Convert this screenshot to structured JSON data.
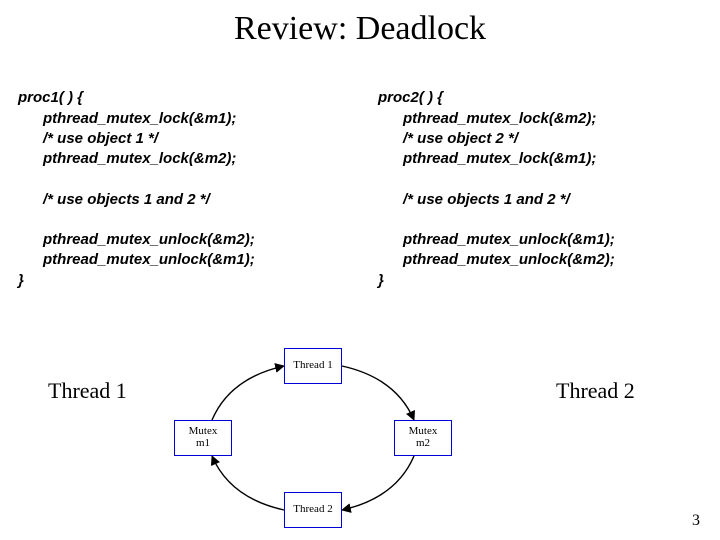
{
  "title": "Review: Deadlock",
  "slide_number": "3",
  "thread1_label": "Thread 1",
  "thread2_label": "Thread 2",
  "proc1": {
    "l0": "proc1( ) {",
    "l1": "      pthread_mutex_lock(&m1);",
    "l2": "      /* use object 1 */",
    "l3": "      pthread_mutex_lock(&m2);",
    "l4": "",
    "l5": "      /* use objects 1 and 2 */",
    "l6": "",
    "l7": "      pthread_mutex_unlock(&m2);",
    "l8": "      pthread_mutex_unlock(&m1);",
    "l9": "}"
  },
  "proc2": {
    "l0": "proc2( ) {",
    "l1": "      pthread_mutex_lock(&m2);",
    "l2": "      /* use object 2 */",
    "l3": "      pthread_mutex_lock(&m1);",
    "l4": "",
    "l5": "      /* use objects 1 and 2 */",
    "l6": "",
    "l7": "      pthread_mutex_unlock(&m1);",
    "l8": "      pthread_mutex_unlock(&m2);",
    "l9": "}"
  },
  "diagram": {
    "top": "Thread 1",
    "bottom": "Thread 2",
    "left_line1": "Mutex",
    "left_line2": "m1",
    "right_line1": "Mutex",
    "right_line2": "m2"
  }
}
